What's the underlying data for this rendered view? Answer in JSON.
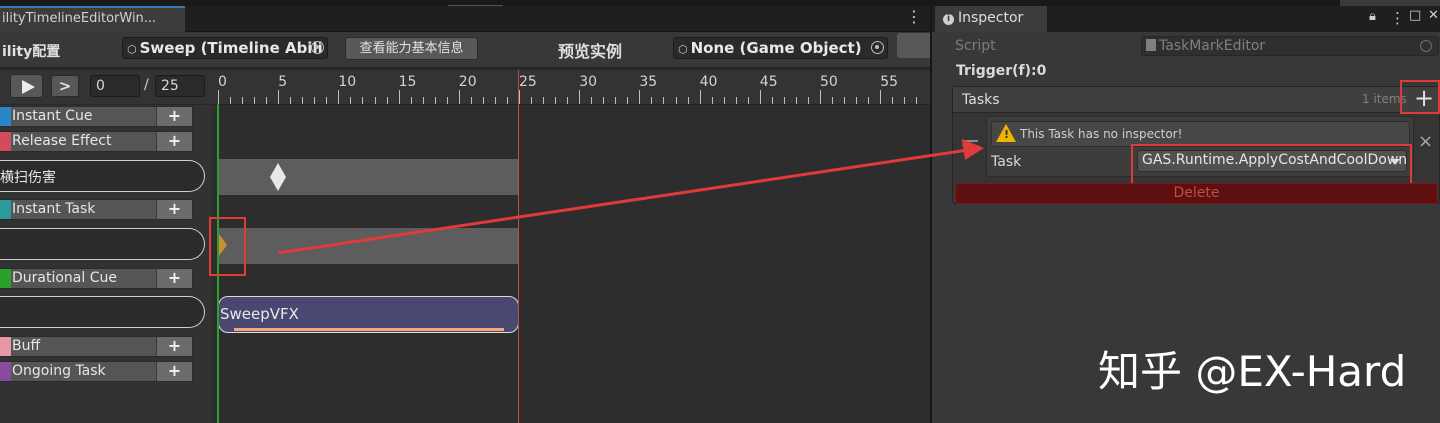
{
  "window": {
    "tab_title": "ilityTimelineEditorWin..."
  },
  "toolbar": {
    "ability_label": "ility配置",
    "ability_asset": "Sweep (Timeline Abili",
    "view_info_button": "查看能力基本信息",
    "preview_label": "预览实例",
    "preview_object": "None (Game Object)"
  },
  "controls": {
    "step_label": ">",
    "current_frame": "0",
    "separator": "/",
    "total_frames": "25"
  },
  "ruler": {
    "labels": [
      "0",
      "5",
      "10",
      "15",
      "20",
      "25",
      "30",
      "35",
      "40",
      "45",
      "50",
      "55"
    ]
  },
  "tracks": [
    {
      "label": "Instant Cue",
      "color": "#2a86c9",
      "plus": "+"
    },
    {
      "label": "Release Effect",
      "color": "#d44a5e",
      "plus": "+"
    },
    {
      "label": "Instant Task",
      "color": "#2a9a9a",
      "plus": "+"
    },
    {
      "label": "Durational Cue",
      "color": "#2aa12a",
      "plus": "+"
    },
    {
      "label": "Buff",
      "color": "#e896a6",
      "plus": "+"
    },
    {
      "label": "Ongoing Task",
      "color": "#8a4aa0",
      "plus": "+"
    }
  ],
  "items": {
    "sweep_damage": "横扫伤害",
    "task_item": "",
    "vfx_item": ""
  },
  "clips": {
    "vfx_name": "SweepVFX"
  },
  "inspector": {
    "tab_title": "Inspector",
    "script_label": "Script",
    "script_value": "TaskMarkEditor",
    "trigger": "Trigger(f):0",
    "tasks_label": "Tasks",
    "items_count": "1 items",
    "add_symbol": "+",
    "warning": "This Task has no inspector!",
    "task_label": "Task",
    "task_value": "GAS.Runtime.ApplyCostAndCoolDown",
    "delete_label": "Delete",
    "remove_symbol": "×"
  },
  "colors": {
    "annotation": "#e03a3a",
    "playhead": "#2aa12a",
    "end_marker": "#c24a4a",
    "vfx_clip": "#4a4770"
  },
  "watermark": "知乎 @EX-Hard"
}
